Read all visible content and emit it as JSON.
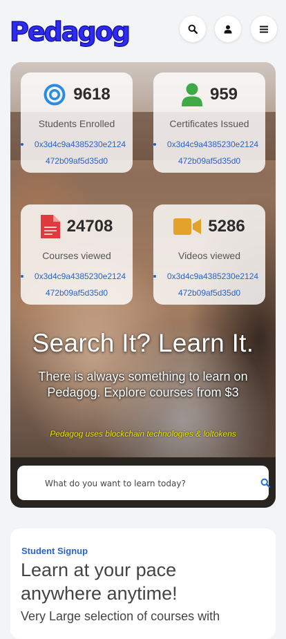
{
  "brand": {
    "logo_text": "Pedagog"
  },
  "header": {
    "icons": [
      "search-icon",
      "user-icon",
      "menu-icon"
    ]
  },
  "stats": [
    {
      "icon": "target-icon",
      "icon_color": "#2a8ce0",
      "number": "9618",
      "label": "Students Enrolled",
      "addr_line1": "0x3d4c9a4385230e2124",
      "addr_line2": "472b09af5d35d0"
    },
    {
      "icon": "person-icon",
      "icon_color": "#3faa45",
      "number": "959",
      "label": "Certificates Issued",
      "addr_line1": "0x3d4c9a4385230e2124",
      "addr_line2": "472b09af5d35d0"
    },
    {
      "icon": "document-icon",
      "icon_color": "#e0393e",
      "number": "24708",
      "label": "Courses viewed",
      "addr_line1": "0x3d4c9a4385230e2124",
      "addr_line2": "472b09af5d35d0"
    },
    {
      "icon": "video-camera-icon",
      "icon_color": "#e3a22a",
      "number": "5286",
      "label": "Videos viewed",
      "addr_line1": "0x3d4c9a4385230e2124",
      "addr_line2": "472b09af5d35d0"
    }
  ],
  "hero": {
    "headline": "Search It? Learn It.",
    "subhead": "There is always something to learn on Pedagog. Explore courses from $3",
    "tagline": "Pedagog uses blockchain technologies & loltokens"
  },
  "search": {
    "placeholder": "What do you want to learn today?",
    "button_icon": "search-icon",
    "button_color": "#1f6fd6"
  },
  "signup": {
    "kicker": "Student Signup",
    "title": "Learn at your pace anywhere anytime!",
    "subtitle": "Very Large selection of courses with"
  }
}
